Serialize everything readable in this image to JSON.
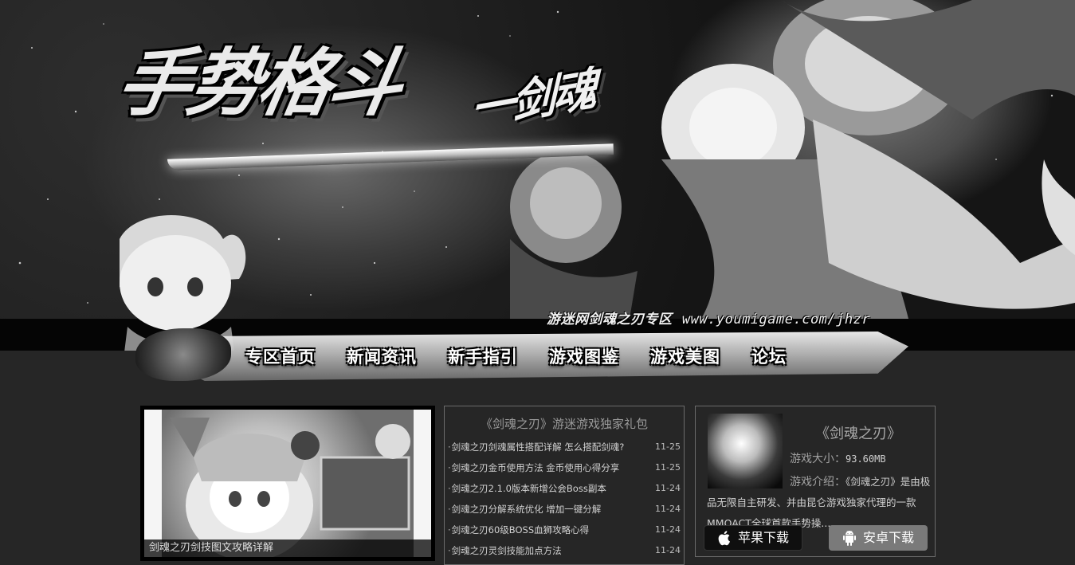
{
  "banner": {
    "title_art": "手势格斗",
    "subtitle_art": "一剑魂",
    "caption": "游迷网剑魂之刃专区",
    "url": "www.youmigame.com/jhzr"
  },
  "nav": [
    {
      "label": "专区首页"
    },
    {
      "label": "新闻资讯"
    },
    {
      "label": "新手指引"
    },
    {
      "label": "游戏图鉴"
    },
    {
      "label": "游戏美图"
    },
    {
      "label": "论坛"
    }
  ],
  "promo": {
    "caption": "剑魂之刃剑技图文攻略详解"
  },
  "news": {
    "title": "《剑魂之刃》游迷游戏独家礼包",
    "items": [
      {
        "title": "剑魂之刃剑魂属性搭配详解 怎么搭配剑魂?",
        "date": "11-25"
      },
      {
        "title": "剑魂之刃金币使用方法 金币使用心得分享",
        "date": "11-25"
      },
      {
        "title": "剑魂之刃2.1.0版本新增公会Boss副本",
        "date": "11-24"
      },
      {
        "title": "剑魂之刃分解系统优化 增加一键分解",
        "date": "11-24"
      },
      {
        "title": "剑魂之刃60级BOSS血狮攻略心得",
        "date": "11-24"
      },
      {
        "title": "剑魂之刃灵剑技能加点方法",
        "date": "11-24"
      }
    ]
  },
  "game_info": {
    "title": "《剑魂之刃》",
    "size_label": "游戏大小：",
    "size_value": "93.60MB",
    "desc_label": "游戏介绍：",
    "desc_text": "《剑魂之刃》是由极品无限自主研发、并由昆仑游戏独家代理的一款MMOACT全球首款手势操...",
    "ios_button": "苹果下载",
    "android_button": "安卓下载"
  }
}
